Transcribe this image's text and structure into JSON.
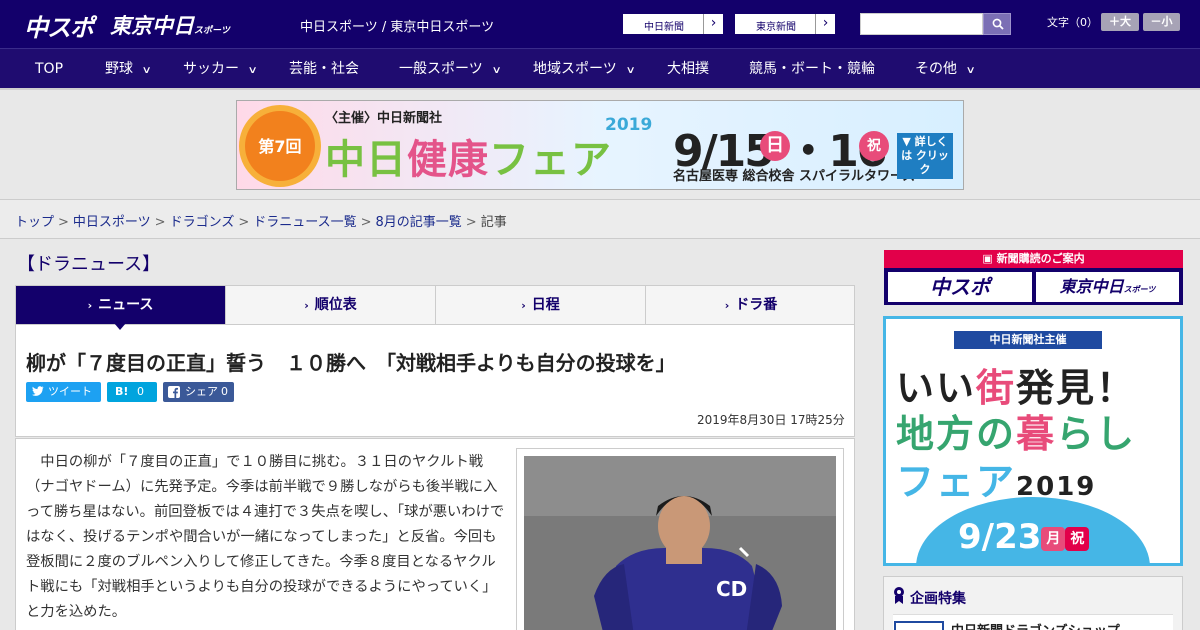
{
  "header": {
    "logo_chunichi_sports": "中スポ",
    "logo_tokyo_chunichi": "東京中日",
    "logo_tokyo_chunichi_sub": "スポーツ",
    "site_links": "中日スポーツ / 東京中日スポーツ",
    "paper_links": [
      "中日新聞",
      "東京新聞"
    ],
    "search_placeholder": "",
    "font_size_label": "文字（0）",
    "font_increase": "＋大",
    "font_decrease": "－小"
  },
  "nav": {
    "items": [
      "TOP",
      "野球",
      "サッカー",
      "芸能・社会",
      "一般スポーツ",
      "地域スポーツ",
      "大相撲",
      "競馬・ボート・競輪",
      "その他"
    ]
  },
  "banner": {
    "badge": "第7回",
    "host": "〈主催〉中日新聞社",
    "title_green": "中日",
    "title_pink": "健康",
    "title_tail": "フェア",
    "year": "2019",
    "dates": "9/15 ・16",
    "day1": "日",
    "day2": "祝",
    "venue": "名古屋医専 総合校舎 スパイラルタワーズ",
    "detail": "▼ 詳しくは クリック"
  },
  "breadcrumb": {
    "items": [
      "トップ",
      "中日スポーツ",
      "ドラゴンズ",
      "ドラニュース一覧",
      "8月の記事一覧"
    ],
    "current": "記事",
    "separator": ">"
  },
  "section_title": "【ドラニュース】",
  "tabs": [
    "ニュース",
    "順位表",
    "日程",
    "ドラ番"
  ],
  "article": {
    "headline": "柳が「７度目の正直」誓う　１０勝へ　「対戦相手よりも自分の投球を」",
    "share": {
      "tweet": "ツイート",
      "hatena_icon": "B!",
      "hatena_count": "0",
      "facebook": "シェア",
      "facebook_count": "0"
    },
    "date": "2019年8月30日 17時25分",
    "body": "中日の柳が「７度目の正直」で１０勝目に挑む。３１日のヤクルト戦（ナゴヤドーム）に先発予定。今季は前半戦で９勝しながらも後半戦に入って勝ち星はない。前回登板では４連打で３失点を喫し、「球が悪いわけではなく、投げるテンポや間合いが一緒になってしまった」と反省。今回も登板間に２度のブルペン入りして修正してきた。今季８度目となるヤクルト戦にも「対戦相手というよりも自分の投球ができるようにやっていく」と力を込めた。",
    "photo_jersey_logo": "CD"
  },
  "sidebar": {
    "subscribe_head": "新聞購読のご案内",
    "subscribe_buttons": [
      "中スポ",
      "東京中日"
    ],
    "subscribe_button_sub": "スポーツ",
    "ad": {
      "header": "中日新聞社主催",
      "line1_a": "いい",
      "line1_b": "街",
      "line1_c": "発見！",
      "line2_a": "地方の",
      "line2_b": "暮",
      "line2_c": "らし",
      "line3_a": "フェア",
      "line3_year": "2019",
      "date": "9/23",
      "weekday": "月",
      "holiday": "祝"
    },
    "feature_title": "企画特集",
    "feature_item": "中日新聞ドラゴンズショップ"
  },
  "colors": {
    "header_bg": "#13006b",
    "accent_pink": "#e2004a",
    "twitter": "#1da1f2",
    "hatena": "#00a4de",
    "facebook": "#3b5998"
  }
}
